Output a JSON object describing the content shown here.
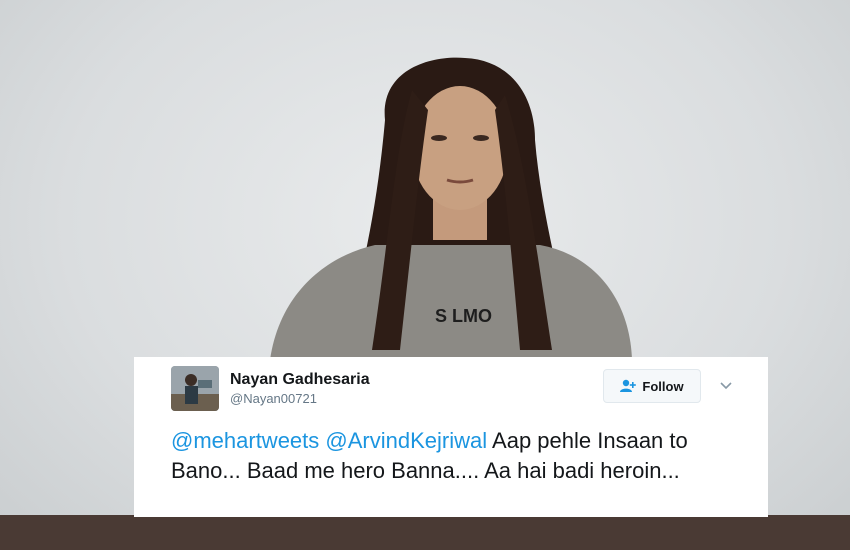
{
  "tweet": {
    "author": {
      "display_name": "Nayan Gadhesaria",
      "handle": "@Nayan00721",
      "avatar_icon": "profile-photo"
    },
    "follow_button": {
      "label": "Follow",
      "icon": "add-user-icon"
    },
    "more_icon": "chevron-down-icon",
    "text": {
      "mention_1": "@mehartweets",
      "mention_2": "@ArvindKejriwal",
      "body": "Aap pehle Insaan to Bano... Baad me hero Banna.... Aa hai badi heroin..."
    }
  },
  "background": {
    "shirt_text": "S LMO",
    "colors": {
      "backdrop": "#dcdfe0",
      "hair": "#2a1a14",
      "shirt": "#8c8a85",
      "mention": "#1b95e0"
    }
  }
}
